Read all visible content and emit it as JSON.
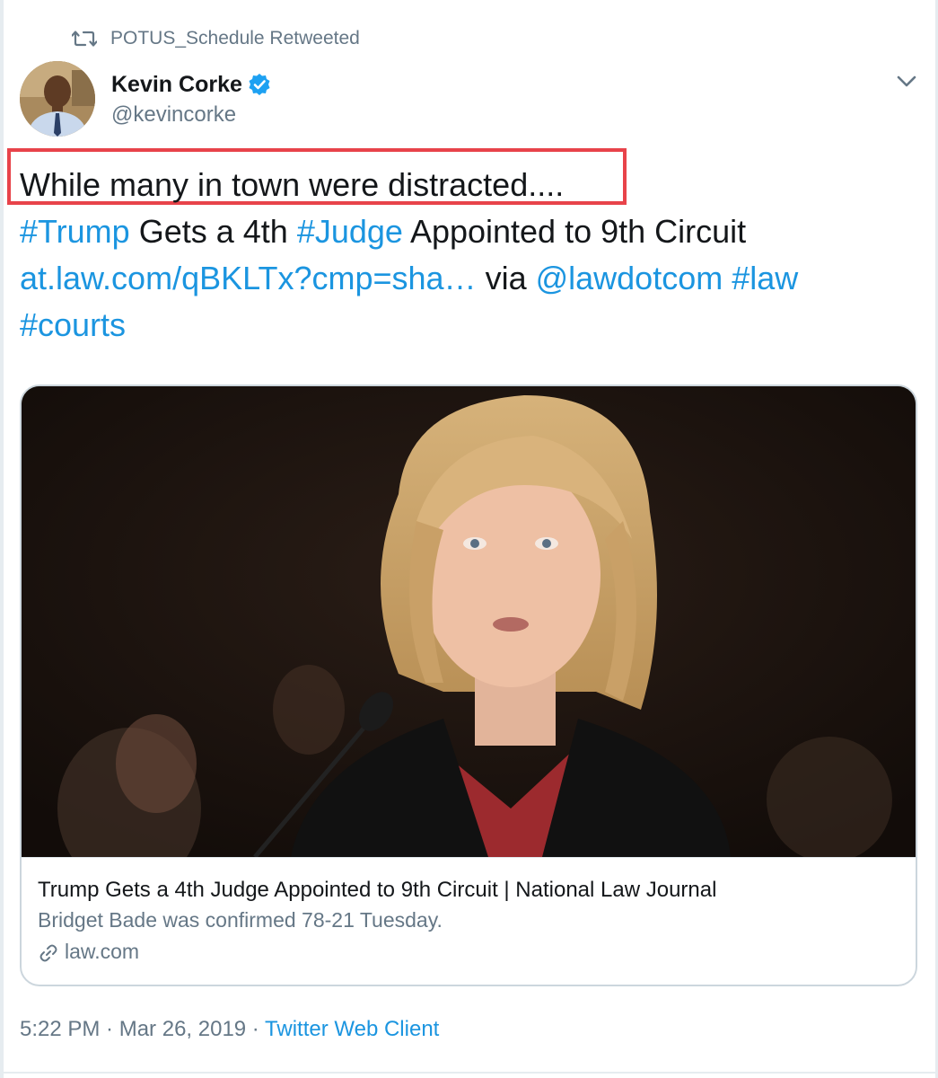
{
  "retweet": {
    "icon": "retweet-icon",
    "label": "POTUS_Schedule Retweeted"
  },
  "author": {
    "name": "Kevin Corke",
    "handle": "@kevincorke",
    "verified_icon": "verified-badge-icon",
    "avatar_icon": "avatar"
  },
  "menu": {
    "icon": "chevron-down-icon"
  },
  "tweet": {
    "line1": "While many in town were distracted....",
    "hashtag_trump": "#Trump",
    "text_gets": " Gets a 4th ",
    "hashtag_judge": "#Judge",
    "text_appointed": " Appointed to 9th Circuit",
    "url": "at.law.com/qBKLTx?cmp=sha…",
    "text_via": " via ",
    "mention": "@lawdotcom",
    "space": " ",
    "hashtag_law": "#law",
    "hashtag_courts": "#courts"
  },
  "card": {
    "image_desc": "photo",
    "title": "Trump Gets a 4th Judge Appointed to 9th Circuit | National Law Journal",
    "description": "Bridget Bade was confirmed 78-21 Tuesday.",
    "domain": "law.com",
    "link_icon": "link-icon"
  },
  "footer": {
    "time": "5:22 PM",
    "separator1": " · ",
    "date": "Mar 26, 2019",
    "separator2": " · ",
    "source": "Twitter Web Client"
  },
  "colors": {
    "link": "#1b95e0",
    "muted": "#657786",
    "text": "#14171a",
    "highlight": "#e8434a"
  }
}
